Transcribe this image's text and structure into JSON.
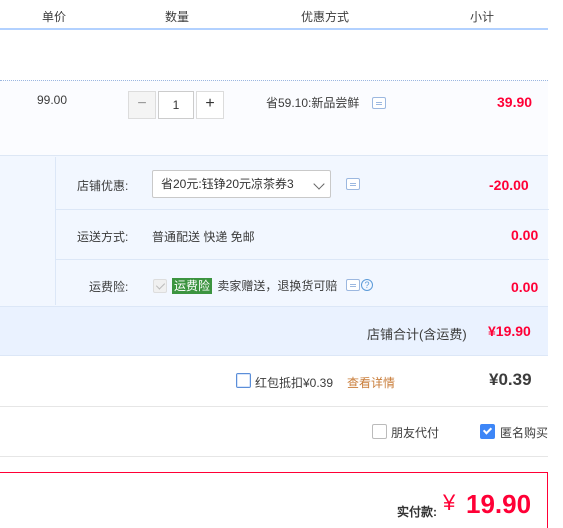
{
  "header": {
    "unit_price": "单价",
    "quantity": "数量",
    "discount_method": "优惠方式",
    "subtotal": "小计"
  },
  "item": {
    "unit_price": "99.00",
    "quantity": "1",
    "minus": "−",
    "plus": "+",
    "promotion": "省59.10:新品尝鲜",
    "subtotal": "39.90"
  },
  "shop": {
    "discount_label": "店铺优惠:",
    "discount_selected": "省20元:钰铮20元凉茶券3",
    "discount_amount": "-20.00",
    "shipping_label": "运送方式:",
    "shipping_value": "普通配送 快递 免邮",
    "shipping_amount": "0.00",
    "insurance_label": "运费险:",
    "insurance_badge": "运费险",
    "insurance_desc": "卖家赠送，退换货可赔",
    "insurance_amount": "0.00",
    "total_label": "店铺合计(含运费)",
    "total_amount": "¥19.90"
  },
  "redpacket": {
    "label": "红包抵扣¥0.39",
    "details_link": "查看详情",
    "amount": "¥0.39"
  },
  "options": {
    "friend_pay": "朋友代付",
    "anonymous": "匿名购买"
  },
  "payment": {
    "label": "实付款:",
    "currency": "¥",
    "amount": "19.90"
  },
  "colors": {
    "price_red": "#ff0036",
    "link_orange": "#c97d3a",
    "badge_green": "#3c9440",
    "checkbox_blue": "#3d86f7"
  }
}
